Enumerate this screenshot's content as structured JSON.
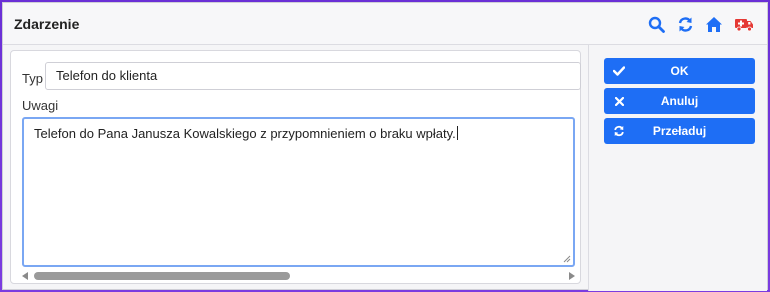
{
  "window": {
    "title": "Zdarzenie",
    "toolbar_icons": [
      "search-icon",
      "refresh-icon",
      "home-icon",
      "ambulance-icon"
    ]
  },
  "form": {
    "typ_label": "Typ",
    "typ_value": "Telefon do klienta",
    "uwagi_label": "Uwagi",
    "uwagi_value": "Telefon do Pana Janusza Kowalskiego z przypomnieniem o braku wpłaty."
  },
  "actions": {
    "ok_label": "OK",
    "cancel_label": "Anuluj",
    "reload_label": "Przeładuj"
  },
  "colors": {
    "accent": "#1e6ef5",
    "ambulance": "#e53935"
  }
}
